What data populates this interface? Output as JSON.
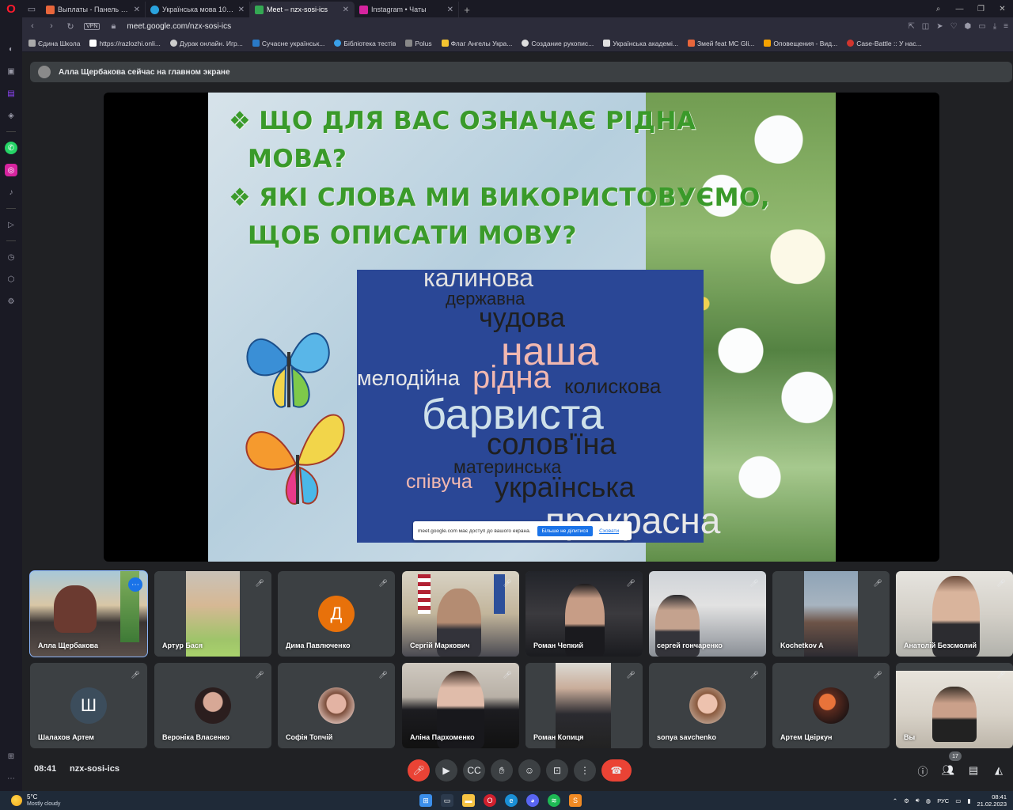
{
  "browser": {
    "tabs": [
      {
        "label": "Выплаты - Панель управл",
        "fav_color": "#e8663b"
      },
      {
        "label": "Українська мова 10 клас",
        "fav_color": "#2aa3de"
      },
      {
        "label": "Meet – nzx-sosi-ics",
        "fav_color": "#34a853",
        "active": true
      },
      {
        "label": "Instagram • Чаты",
        "fav_color": "#d6249f"
      }
    ],
    "url": "meet.google.com/nzx-sosi-ics",
    "vpn": "VPN",
    "bookmarks": [
      {
        "label": "Єдина Школа",
        "color": "#aaaaaa"
      },
      {
        "label": "https://razlozhi.onli...",
        "color": "#ffffff"
      },
      {
        "label": "Дурак онлайн. Игр...",
        "color": "#cccccc"
      },
      {
        "label": "Сучасне українськ...",
        "color": "#2a7ac7"
      },
      {
        "label": "Бібліотека тестів",
        "color": "#3aa0e8"
      },
      {
        "label": "Polus",
        "color": "#888888"
      },
      {
        "label": "Флаг Ангелы Укра...",
        "color": "#f4c430"
      },
      {
        "label": "Создание рукопис...",
        "color": "#dddddd"
      },
      {
        "label": "Українська академі...",
        "color": "#e0e0e0"
      },
      {
        "label": "Змей feat MC Gli...",
        "color": "#e8663b"
      },
      {
        "label": "Оповещения - Вид...",
        "color": "#f4a100"
      },
      {
        "label": "Case-Battle :: У нас...",
        "color": "#d0352e"
      }
    ]
  },
  "banner": {
    "text": "Алла Щербакова сейчас на главном экране"
  },
  "slide": {
    "question1_line1": "ЩО ДЛЯ ВАС ОЗНАЧАЄ РІДНА",
    "question1_line2": "МОВА?",
    "question2_line1": "ЯКІ СЛОВА МИ ВИКОРИСТОВУЄМО,",
    "question2_line2": "ЩОБ ОПИСАТИ МОВУ?",
    "bullet": "❖",
    "words": {
      "w1": "калинова",
      "w2": "державна",
      "w3": "чудова",
      "w4": "наша",
      "w5": "мелодійна",
      "w6": "рідна",
      "w7": "колискова",
      "w8": "барвиста",
      "w9": "солов'їна",
      "w10": "материнська",
      "w11": "співуча",
      "w12": "українська",
      "w13": "прекрасна"
    },
    "toast_text": "meet.google.com має доступ до вашого екрана.",
    "toast_stop": "Більше не ділитися",
    "toast_hide": "Сховати"
  },
  "participants_row1": [
    {
      "name": "Алла Щербакова"
    },
    {
      "name": "Артур Бася"
    },
    {
      "name": "Дима Павлюченко",
      "letter": "Д",
      "avatar_color": "#e8710a"
    },
    {
      "name": "Сергій Маркович"
    },
    {
      "name": "Роман Чепкий"
    },
    {
      "name": "сергей гончаренко"
    },
    {
      "name": "Kochetkov A"
    },
    {
      "name": "Анатолій Безсмолий"
    }
  ],
  "participants_row2": [
    {
      "name": "Шалахов Артем",
      "letter": "Ш",
      "avatar_color": "#3c4d5c"
    },
    {
      "name": "Вероніка Власенко"
    },
    {
      "name": "Софія Топчій"
    },
    {
      "name": "Аліна Пархоменко"
    },
    {
      "name": "Роман Копиця"
    },
    {
      "name": "sonya savchenko"
    },
    {
      "name": "Артем Цвіркун"
    },
    {
      "name": "Вы"
    }
  ],
  "controls": {
    "time": "08:41",
    "meeting_code": "nzx-sosi-ics",
    "people_count": "17"
  },
  "taskbar": {
    "temp": "5°C",
    "weather": "Mostly cloudy",
    "lang": "РУС",
    "clock_time": "08:41",
    "clock_date": "21.02.2023"
  }
}
